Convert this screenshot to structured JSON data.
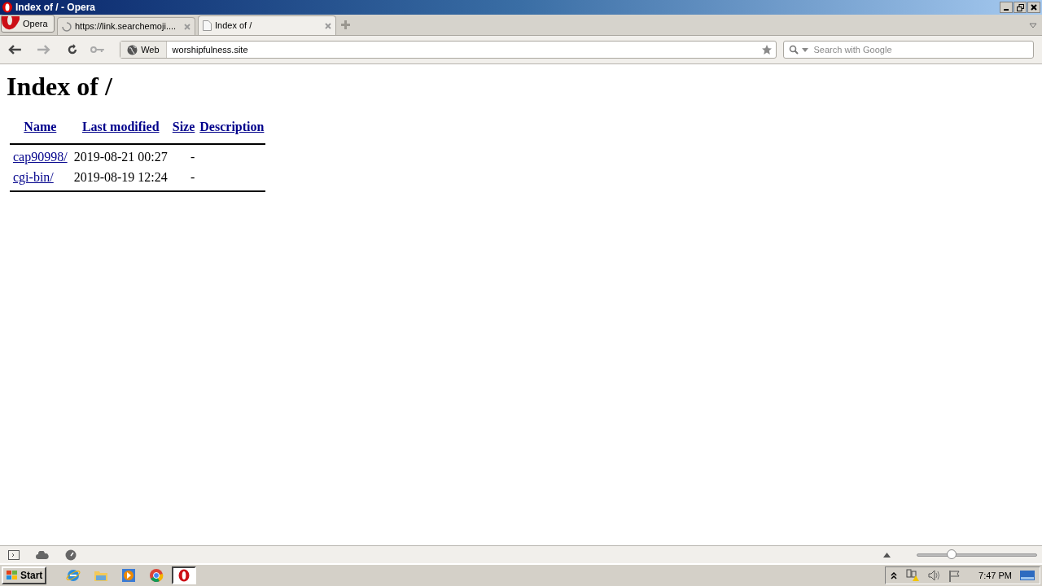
{
  "window": {
    "title": "Index of / - Opera"
  },
  "menu_button": "Opera",
  "tabs": [
    {
      "label": "https://link.searchemoji....",
      "selected": false,
      "loading": true
    },
    {
      "label": "Index of /",
      "selected": true,
      "loading": false
    }
  ],
  "address_bar": {
    "badge": "Web",
    "value": "worshipfulness.site"
  },
  "search": {
    "placeholder": "Search with Google"
  },
  "page": {
    "heading": "Index of /",
    "columns": [
      "Name",
      "Last modified",
      "Size",
      "Description"
    ],
    "rows": [
      {
        "name": "cap90998/",
        "modified": "2019-08-21 00:27",
        "size": "-"
      },
      {
        "name": "cgi-bin/",
        "modified": "2019-08-19 12:24",
        "size": "-"
      }
    ]
  },
  "zoom_slider": {
    "level": 0.27
  },
  "taskbar": {
    "start": "Start",
    "clock": "7:47 PM"
  }
}
